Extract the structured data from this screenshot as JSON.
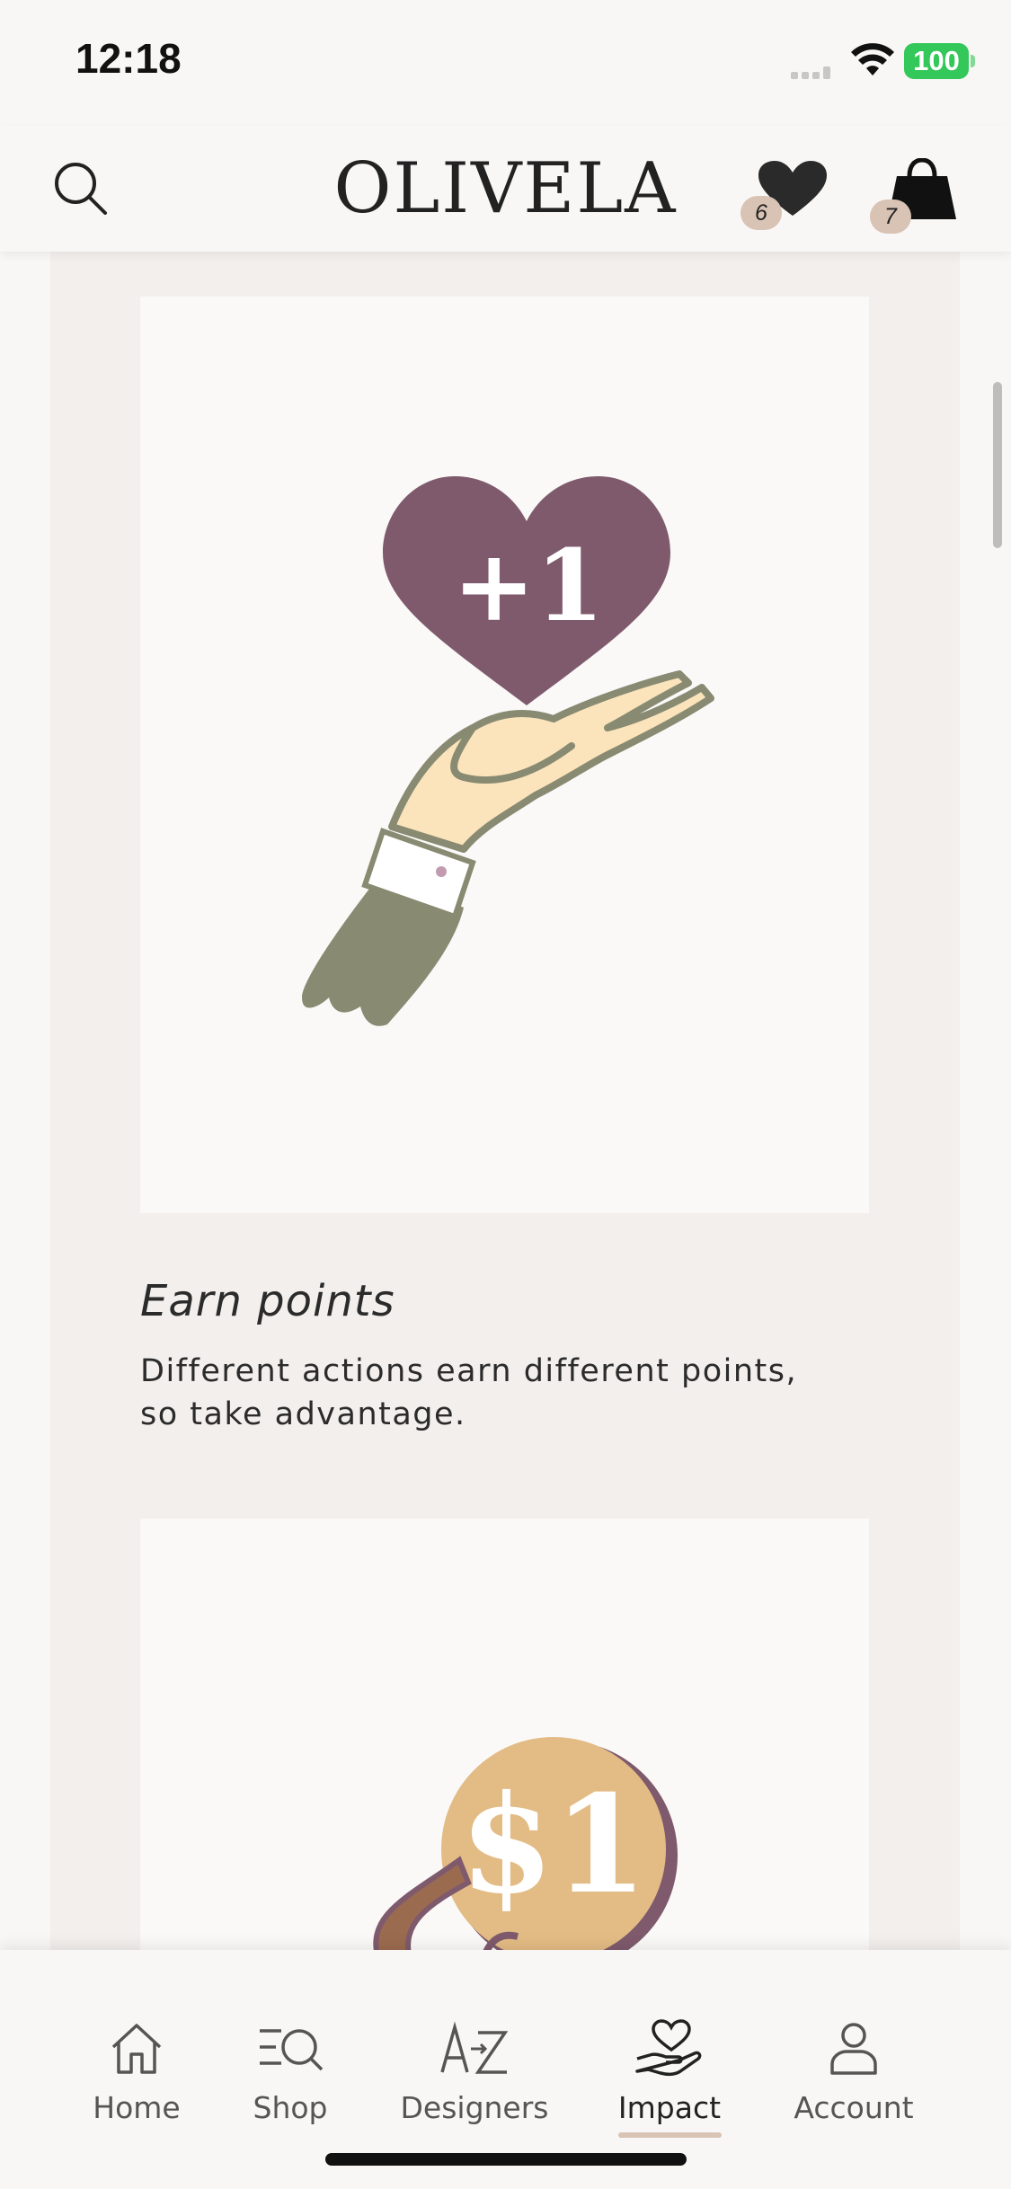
{
  "status_bar": {
    "time": "12:18",
    "battery": "100"
  },
  "header": {
    "logo": "OLIVELA",
    "wishlist_count": "6",
    "bag_count": "7"
  },
  "cards": [
    {
      "title": "Earn points",
      "description": "Different actions earn different points, so take advantage.",
      "illustration_text": "+1"
    },
    {
      "illustration_text": "$1"
    }
  ],
  "tabs": [
    {
      "label": "Home",
      "icon": "home-icon"
    },
    {
      "label": "Shop",
      "icon": "shop-icon"
    },
    {
      "label": "Designers",
      "icon": "designers-icon"
    },
    {
      "label": "Impact",
      "icon": "impact-icon",
      "active": true
    },
    {
      "label": "Account",
      "icon": "account-icon"
    }
  ],
  "colors": {
    "accent": "#d8c3b5",
    "heart": "#7e5a6c",
    "coin": "#e3bb84",
    "sleeve": "#888a72",
    "skin": "#fbe4bb"
  }
}
